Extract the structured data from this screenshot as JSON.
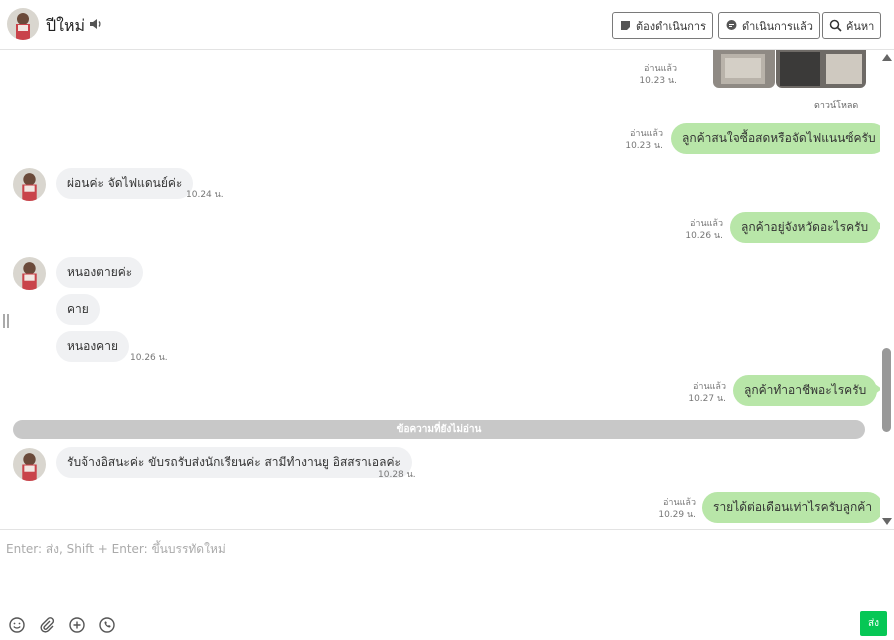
{
  "header": {
    "title": "ปีใหม่",
    "btn_todo": "ต้องดำเนินการ",
    "btn_done": "ดำเนินการแล้ว",
    "btn_search": "ค้นหา"
  },
  "messages": [
    {
      "dir": "out",
      "kind": "photos",
      "read": "อ่านแล้ว",
      "time": "10.23 น.",
      "download": "ดาวน์โหลด"
    },
    {
      "dir": "out",
      "text": "ลูกค้าสนใจซื้อสดหรือจัดไฟแนนซ์ครับ",
      "read": "อ่านแล้ว",
      "time": "10.23 น."
    },
    {
      "dir": "in",
      "text": "ผ่อนค่ะ จัดไฟแดนย์ค่ะ",
      "time": "10.24 น."
    },
    {
      "dir": "out",
      "text": "ลูกค้าอยู่จังหวัดอะไรครับ",
      "read": "อ่านแล้ว",
      "time": "10.26 น."
    },
    {
      "dir": "in",
      "text": "หนองตายค่ะ"
    },
    {
      "dir": "in",
      "text": "คาย"
    },
    {
      "dir": "in",
      "text": "หนองคาย",
      "time": "10.26 น."
    },
    {
      "dir": "out",
      "text": "ลูกค้าทำอาชีพอะไรครับ",
      "read": "อ่านแล้ว",
      "time": "10.27 น."
    },
    {
      "dir": "in",
      "text": "รับจ้างอิสนะค่ะ ขับรถรับส่งนักเรียนค่ะ สามีทำงานยู อิสสราเอลค่ะ",
      "time": "10.28 น."
    },
    {
      "dir": "out",
      "text": "รายได้ต่อเดือนเท่าไรครับลูกค้า",
      "read": "อ่านแล้ว",
      "time": "10.29 น."
    }
  ],
  "unread_divider": "ข้อความที่ยังไม่อ่าน",
  "composer": {
    "placeholder": "Enter: ส่ง, Shift + Enter: ขึ้นบรรทัดใหม่",
    "send_label": "ส่ง"
  },
  "colors": {
    "outgoing_bubble": "#b8e6a8",
    "incoming_bubble": "#f0f1f3",
    "send_button": "#06c755"
  },
  "icons": [
    "speaker-icon",
    "note-icon",
    "chat-icon",
    "search-icon",
    "emoji-icon",
    "attach-icon",
    "add-icon",
    "phone-icon"
  ]
}
